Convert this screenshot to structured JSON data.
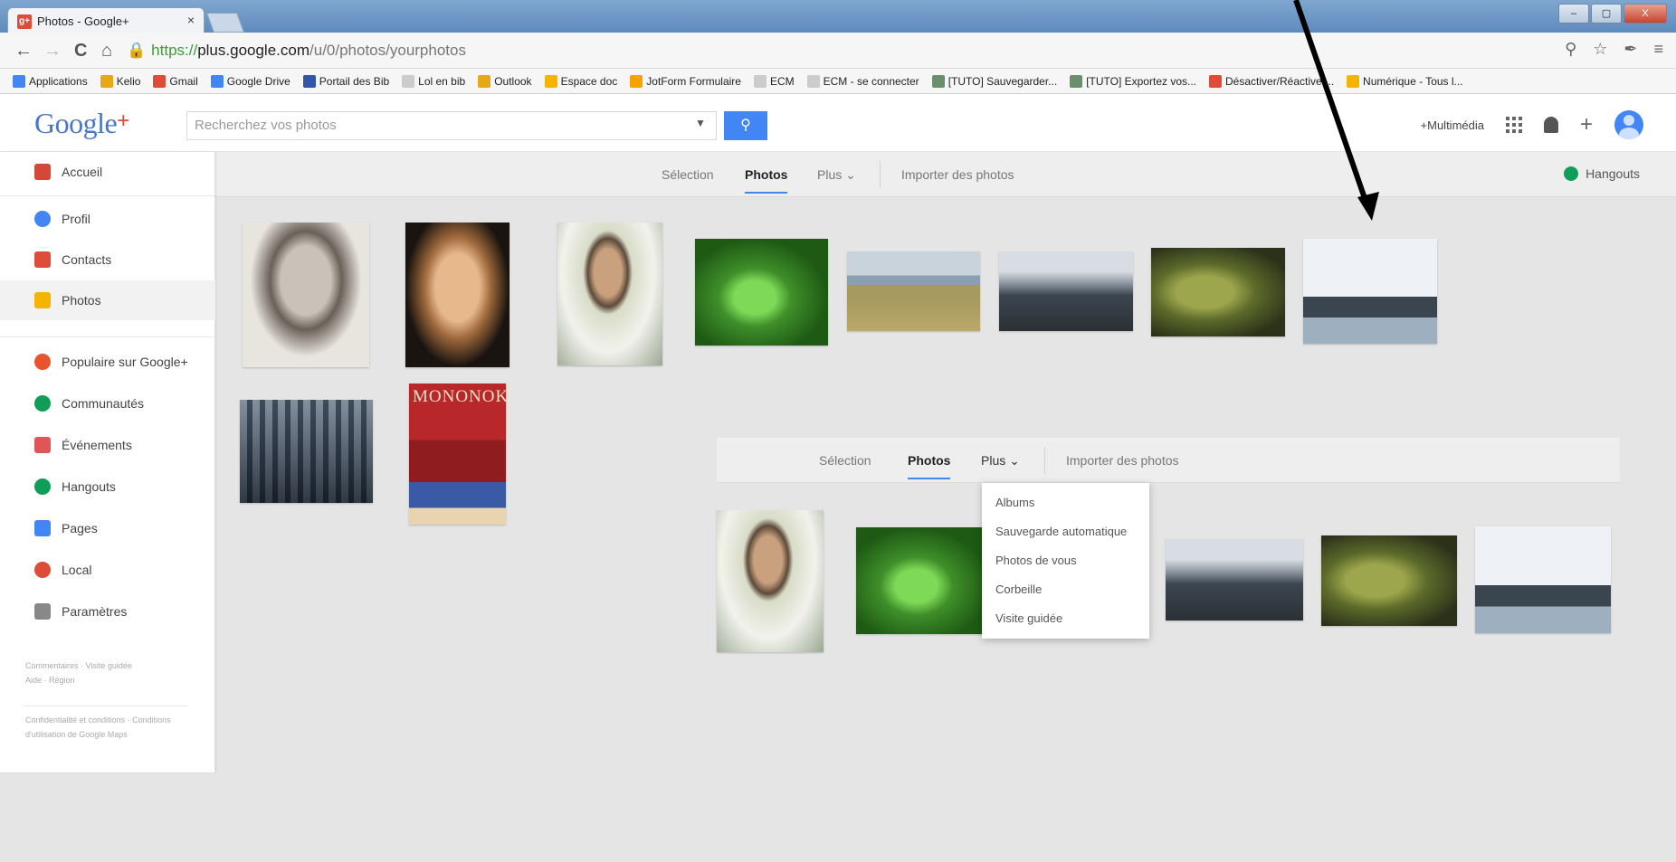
{
  "browser": {
    "tab_title": "Photos - Google+",
    "tab_close": "×",
    "favicon": "g+",
    "url_scheme": "https://",
    "url_host": "plus.google.com",
    "url_path": "/u/0/photos/yourphotos",
    "window_buttons": [
      "–",
      "▢",
      "X"
    ],
    "bookmarks": [
      {
        "label": "Applications",
        "color": "#4285f4"
      },
      {
        "label": "Kelio",
        "color": "#e6a817"
      },
      {
        "label": "Gmail",
        "color": "#dd4b39"
      },
      {
        "label": "Google Drive",
        "color": "#4285f4"
      },
      {
        "label": "Portail des Bib",
        "color": "#3355aa"
      },
      {
        "label": "Lol en bib",
        "color": "#cccccc"
      },
      {
        "label": "Outlook",
        "color": "#e6a817"
      },
      {
        "label": "Espace doc",
        "color": "#f4b400"
      },
      {
        "label": "JotForm Formulaire",
        "color": "#f4a300"
      },
      {
        "label": "ECM",
        "color": "#cccccc"
      },
      {
        "label": "ECM - se connecter",
        "color": "#cccccc"
      },
      {
        "label": "[TUTO] Sauvegarder...",
        "color": "#6a8f6a"
      },
      {
        "label": "[TUTO] Exportez vos...",
        "color": "#6a8f6a"
      },
      {
        "label": "Désactiver/Réactiver...",
        "color": "#dd4b39"
      },
      {
        "label": "Numérique - Tous l...",
        "color": "#f4b400"
      }
    ]
  },
  "header": {
    "logo": "Google",
    "logo_plus": "+",
    "search_placeholder": "Recherchez vos photos",
    "multimedia": "+Multimédia",
    "plus": "+"
  },
  "subnav": {
    "selection": "Sélection",
    "photos": "Photos",
    "plus": "Plus",
    "import": "Importer des photos",
    "hangouts": "Hangouts"
  },
  "sidebar": {
    "items": [
      {
        "label": "Accueil",
        "icon": "home-icon",
        "color": "#d34836"
      },
      {
        "label": "Profil",
        "icon": "profile-icon",
        "color": "#4285f4"
      },
      {
        "label": "Contacts",
        "icon": "contacts-icon",
        "color": "#dd4b39"
      },
      {
        "label": "Photos",
        "icon": "photos-icon",
        "color": "#f4b400"
      },
      {
        "label": "Populaire sur Google+",
        "icon": "fire-icon",
        "color": "#e8542e"
      },
      {
        "label": "Communautés",
        "icon": "communities-icon",
        "color": "#0f9d58"
      },
      {
        "label": "Événements",
        "icon": "calendar-icon",
        "color": "#e05555"
      },
      {
        "label": "Hangouts",
        "icon": "hangouts-icon",
        "color": "#0f9d58"
      },
      {
        "label": "Pages",
        "icon": "pages-icon",
        "color": "#4285f4"
      },
      {
        "label": "Local",
        "icon": "location-pin-icon",
        "color": "#dd4b39"
      },
      {
        "label": "Paramètres",
        "icon": "gear-icon",
        "color": "#888888"
      }
    ],
    "footer1": "Commentaires · Visite guidée",
    "footer2": "Aide · Région",
    "footer3": "Confidentialité et conditions · Conditions d'utilisation de Google Maps"
  },
  "dropdown": {
    "items": [
      "Albums",
      "Sauvegarde automatique",
      "Photos de vous",
      "Corbeille",
      "Visite guidée"
    ]
  },
  "photos": {
    "mononoke_title": "MONONOKE"
  }
}
